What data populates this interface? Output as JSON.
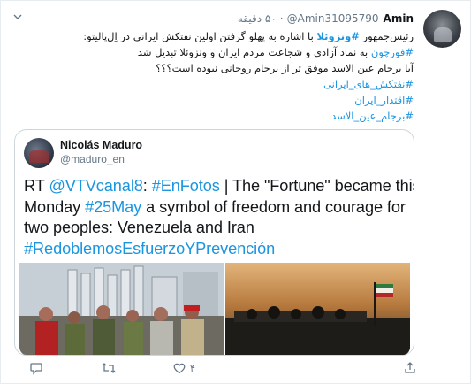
{
  "tweet": {
    "author_name": "Amin",
    "author_handle": "@Amin31095790",
    "separator": "·",
    "timestamp": "۵۰ دقیقه",
    "body": {
      "line1_start": "رئیس‌جمهور ",
      "line1_hashtag": "#ونزوئلا",
      "line1_end": " با اشاره به پهلو گرفتن اولین نفتکش ایرانی در اِل‌پالیتو:",
      "line2_hashtag": "#فورچون",
      "line2_end": " به نماد آزادی و شجاعت مردم ایران و ونزوئلا تبدیل شد",
      "line3": "آیا برجام عین الاسد موفق تر از برجام روحانی نبوده است؟؟؟",
      "hashtags": [
        "#نفتکش_های_ایرانی",
        "#اقتدار_ایران",
        "#برجام_عین_الاسد"
      ]
    }
  },
  "quoted": {
    "author_name": "Nicolás Maduro",
    "author_handle": "@maduro_en",
    "text": {
      "l1_a": "RT ",
      "l1_mention": "@VTVcanal8",
      "l1_b": ": ",
      "l1_tag": "#EnFotos",
      "l1_c": " | The \"Fortune\" became this",
      "l2_a": "Monday ",
      "l2_tag": "#25May",
      "l2_b": " a symbol of freedom and courage for",
      "l3": "two peoples: Venezuela and Iran",
      "l4_tag": "#RedoblemosEsfuerzoYPrevención"
    }
  },
  "actions": {
    "reply_count": "",
    "retweet_count": "",
    "like_count": "۴"
  },
  "colors": {
    "link": "#1b95e0",
    "muted": "#657786",
    "border": "#ccd6dd"
  },
  "icons": [
    "chevron-down-icon",
    "reply-icon",
    "retweet-icon",
    "like-icon",
    "share-icon"
  ]
}
